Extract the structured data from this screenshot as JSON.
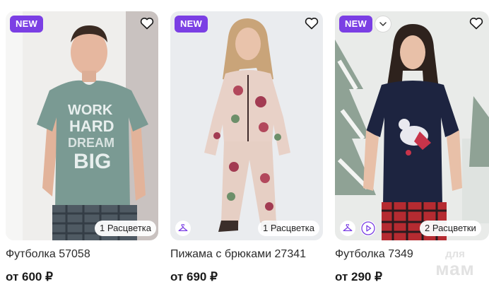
{
  "products": [
    {
      "badge": "NEW",
      "title": "Футболка 57058",
      "price": "от 600 ₽",
      "colors_label": "1 Расцветка",
      "has_hanger": false,
      "has_video": false,
      "has_chevron": false
    },
    {
      "badge": "NEW",
      "title": "Пижама с брюками 27341",
      "price": "от 690 ₽",
      "colors_label": "1 Расцветка",
      "has_hanger": true,
      "has_video": false,
      "has_chevron": false
    },
    {
      "badge": "NEW",
      "title": "Футболка 7349",
      "price": "от 290 ₽",
      "colors_label": "2 Расцветки",
      "has_hanger": true,
      "has_video": true,
      "has_chevron": true
    }
  ],
  "watermark": {
    "line1": "для",
    "line2": "мам"
  },
  "theme": {
    "accent": "#7b3fe4",
    "text": "#1f1f1f"
  },
  "icons": {
    "favorite": "heart-outline-icon",
    "hanger": "hanger-icon",
    "video": "play-icon",
    "expand": "chevron-down-icon"
  }
}
